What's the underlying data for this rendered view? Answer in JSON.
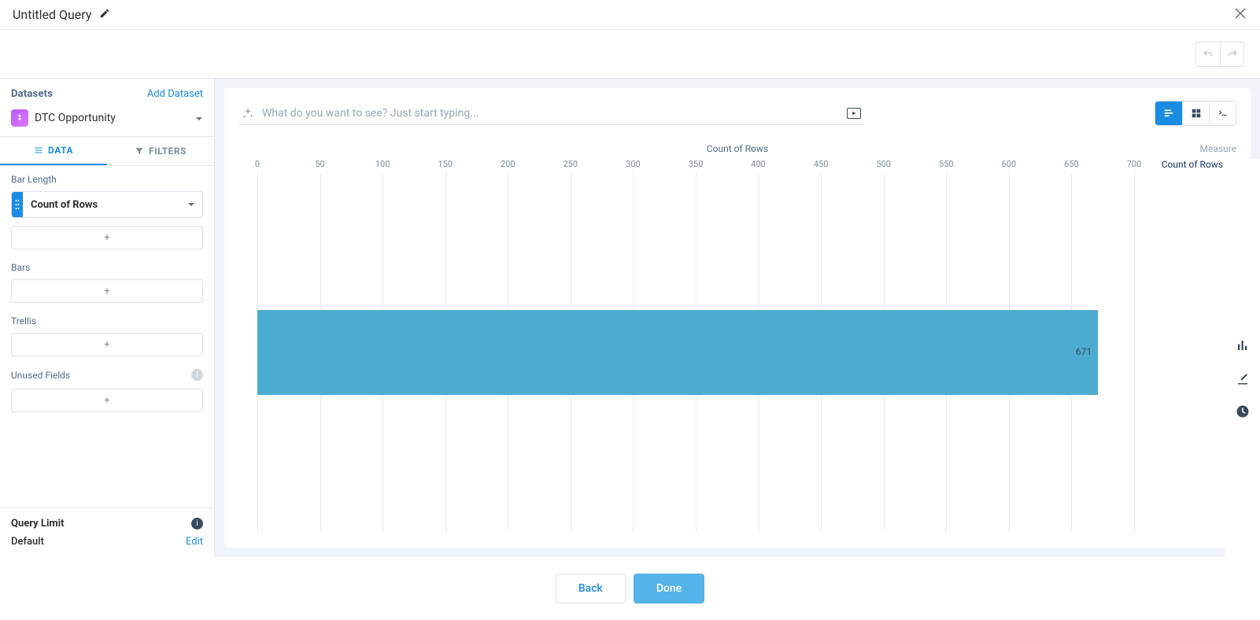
{
  "header": {
    "title": "Untitled Query"
  },
  "datasets": {
    "heading": "Datasets",
    "add_link": "Add Dataset",
    "selected": "DTC Opportunity"
  },
  "tabs": {
    "data": "DATA",
    "filters": "FILTERS"
  },
  "sections": {
    "bar_length": {
      "label": "Bar Length",
      "pill": "Count of Rows"
    },
    "bars": {
      "label": "Bars"
    },
    "trellis": {
      "label": "Trellis"
    },
    "unused": {
      "label": "Unused Fields"
    }
  },
  "query_limit": {
    "label": "Query Limit",
    "value": "Default",
    "edit": "Edit"
  },
  "search": {
    "placeholder": "What do you want to see? Just start typing..."
  },
  "legend": {
    "title": "Measure",
    "item": "Count of Rows"
  },
  "footer": {
    "back": "Back",
    "done": "Done"
  },
  "chart_data": {
    "type": "bar",
    "orientation": "horizontal",
    "title": "Count of Rows",
    "xlabel": "",
    "ylabel": "",
    "xlim": [
      0,
      700
    ],
    "ticks": [
      0,
      50,
      100,
      150,
      200,
      250,
      300,
      350,
      400,
      450,
      500,
      550,
      600,
      650,
      700
    ],
    "categories": [
      ""
    ],
    "series": [
      {
        "name": "Count of Rows",
        "values": [
          671
        ],
        "color": "#4cabd1"
      }
    ]
  }
}
